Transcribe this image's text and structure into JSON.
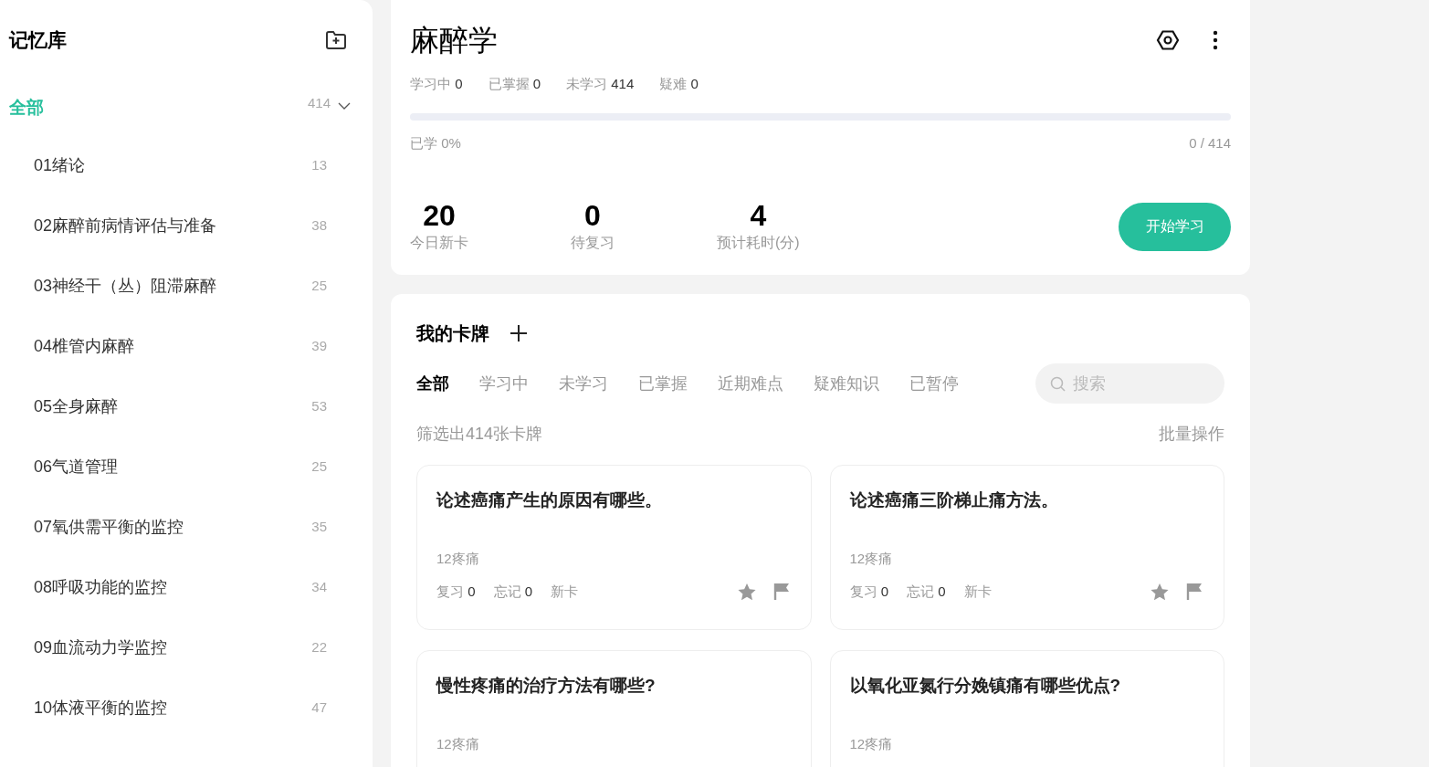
{
  "sidebar": {
    "title": "记忆库",
    "all": {
      "label": "全部",
      "count": "414",
      "selected": true,
      "expanded": true
    },
    "items": [
      {
        "label": "01绪论",
        "count": "13",
        "selected": false
      },
      {
        "label": "02麻醉前病情评估与准备",
        "count": "38",
        "selected": false
      },
      {
        "label": "03神经干（丛）阻滞麻醉",
        "count": "25",
        "selected": false
      },
      {
        "label": "04椎管内麻醉",
        "count": "39",
        "selected": false
      },
      {
        "label": "05全身麻醉",
        "count": "53",
        "selected": false
      },
      {
        "label": "06气道管理",
        "count": "25",
        "selected": false
      },
      {
        "label": "07氧供需平衡的监控",
        "count": "35",
        "selected": false
      },
      {
        "label": "08呼吸功能的监控",
        "count": "34",
        "selected": false
      },
      {
        "label": "09血流动力学监控",
        "count": "22",
        "selected": false
      },
      {
        "label": "10体液平衡的监控",
        "count": "47",
        "selected": false
      }
    ]
  },
  "deck": {
    "title": "麻醉学",
    "counts": [
      {
        "label": "学习中",
        "value": "0"
      },
      {
        "label": "已掌握",
        "value": "0"
      },
      {
        "label": "未学习",
        "value": "414"
      },
      {
        "label": "疑难",
        "value": "0"
      }
    ],
    "progress": {
      "level": 0,
      "label": "已学 0%",
      "reading": "0 / 414"
    },
    "stats": [
      {
        "value": "20",
        "label": "今日新卡"
      },
      {
        "value": "0",
        "label": "待复习"
      },
      {
        "value": "4",
        "label": "预计耗时(分)"
      }
    ],
    "start_button": "开始学习"
  },
  "cards": {
    "title": "我的卡牌",
    "tabs": [
      {
        "label": "全部",
        "selected": true
      },
      {
        "label": "学习中",
        "selected": false
      },
      {
        "label": "未学习",
        "selected": false
      },
      {
        "label": "已掌握",
        "selected": false
      },
      {
        "label": "近期难点",
        "selected": false
      },
      {
        "label": "疑难知识",
        "selected": false
      },
      {
        "label": "已暂停",
        "selected": false
      }
    ],
    "search": {
      "placeholder": "搜索"
    },
    "summary": "筛选出414张卡牌",
    "bulk_action": "批量操作",
    "items": [
      {
        "question": "论述癌痛产生的原因有哪些。",
        "tag": "12疼痛",
        "review_label": "复习",
        "review": "0",
        "forget_label": "忘记",
        "forget": "0",
        "status": "新卡"
      },
      {
        "question": "论述癌痛三阶梯止痛方法。",
        "tag": "12疼痛",
        "review_label": "复习",
        "review": "0",
        "forget_label": "忘记",
        "forget": "0",
        "status": "新卡"
      },
      {
        "question": "慢性疼痛的治疗方法有哪些?",
        "tag": "12疼痛"
      },
      {
        "question": "以氧化亚氮行分娩镇痛有哪些优点?",
        "tag": "12疼痛"
      }
    ]
  }
}
